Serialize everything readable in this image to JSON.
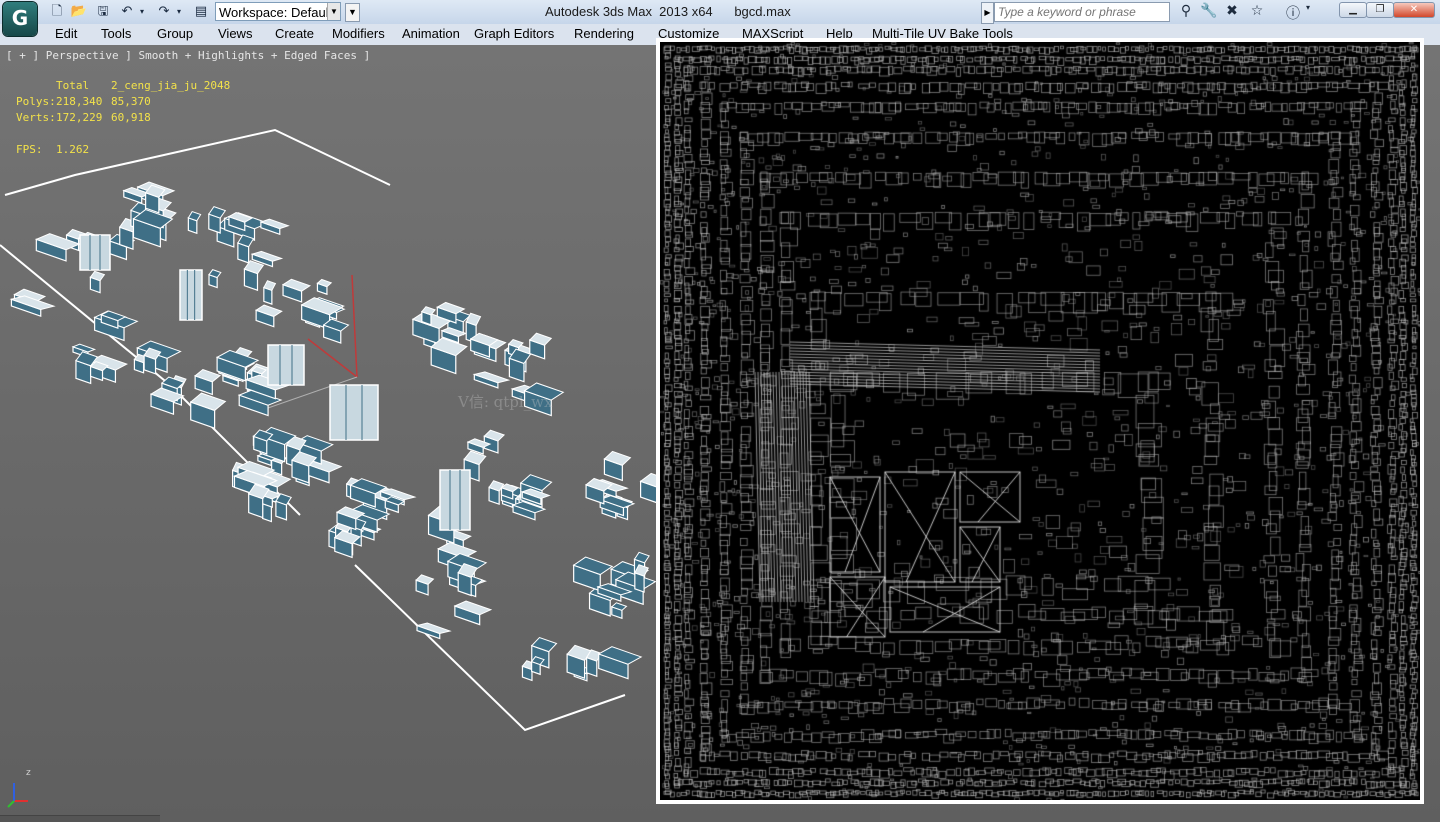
{
  "titlebar": {
    "app_icon": "3dsmax-logo-icon",
    "workspace": "Workspace: Default",
    "window_title": "Autodesk 3ds Max  2013 x64      bgcd.max",
    "search_placeholder": "Type a keyword or phrase"
  },
  "menu": {
    "items": [
      "Edit",
      "Tools",
      "Group",
      "Views",
      "Create",
      "Modifiers",
      "Animation",
      "Graph Editors",
      "Rendering",
      "Customize",
      "MAXScript",
      "Help",
      "Multi-Tile UV Bake Tools"
    ]
  },
  "viewport": {
    "label": "[ + ] Perspective ] Smooth + Highlights + Edged Faces ]",
    "stats": {
      "col_total": "Total",
      "col_object": "2_ceng_jia_ju_2048",
      "polys_label": "Polys:",
      "polys_total": "218,340",
      "polys_object": "85,370",
      "verts_label": "Verts:",
      "verts_total": "172,229",
      "verts_object": "60,918",
      "fps_label": "FPS:",
      "fps": "1.262"
    },
    "watermark": "V信: qtpl_wx",
    "axis_labels": {
      "x": "x",
      "y": "y",
      "z": "z"
    }
  },
  "colors": {
    "viewport_bg": "#6b6b6b",
    "stats_text": "#f3e24a",
    "furniture_body": "#3f6f86",
    "furniture_edge": "#ffffff",
    "uv_bg": "#000000",
    "uv_line": "#bfbfbf"
  }
}
